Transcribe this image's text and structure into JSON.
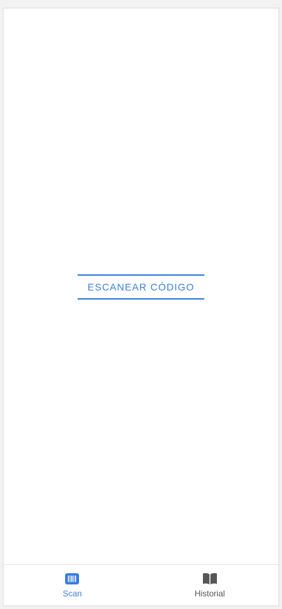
{
  "main": {
    "scan_button_label": "ESCANEAR CÓDIGO"
  },
  "bottom_nav": {
    "items": [
      {
        "label": "Scan",
        "icon": "barcode-icon",
        "active": true
      },
      {
        "label": "Historial",
        "icon": "book-icon",
        "active": false
      }
    ]
  },
  "colors": {
    "accent": "#3b7ddd",
    "inactive": "#555555"
  }
}
